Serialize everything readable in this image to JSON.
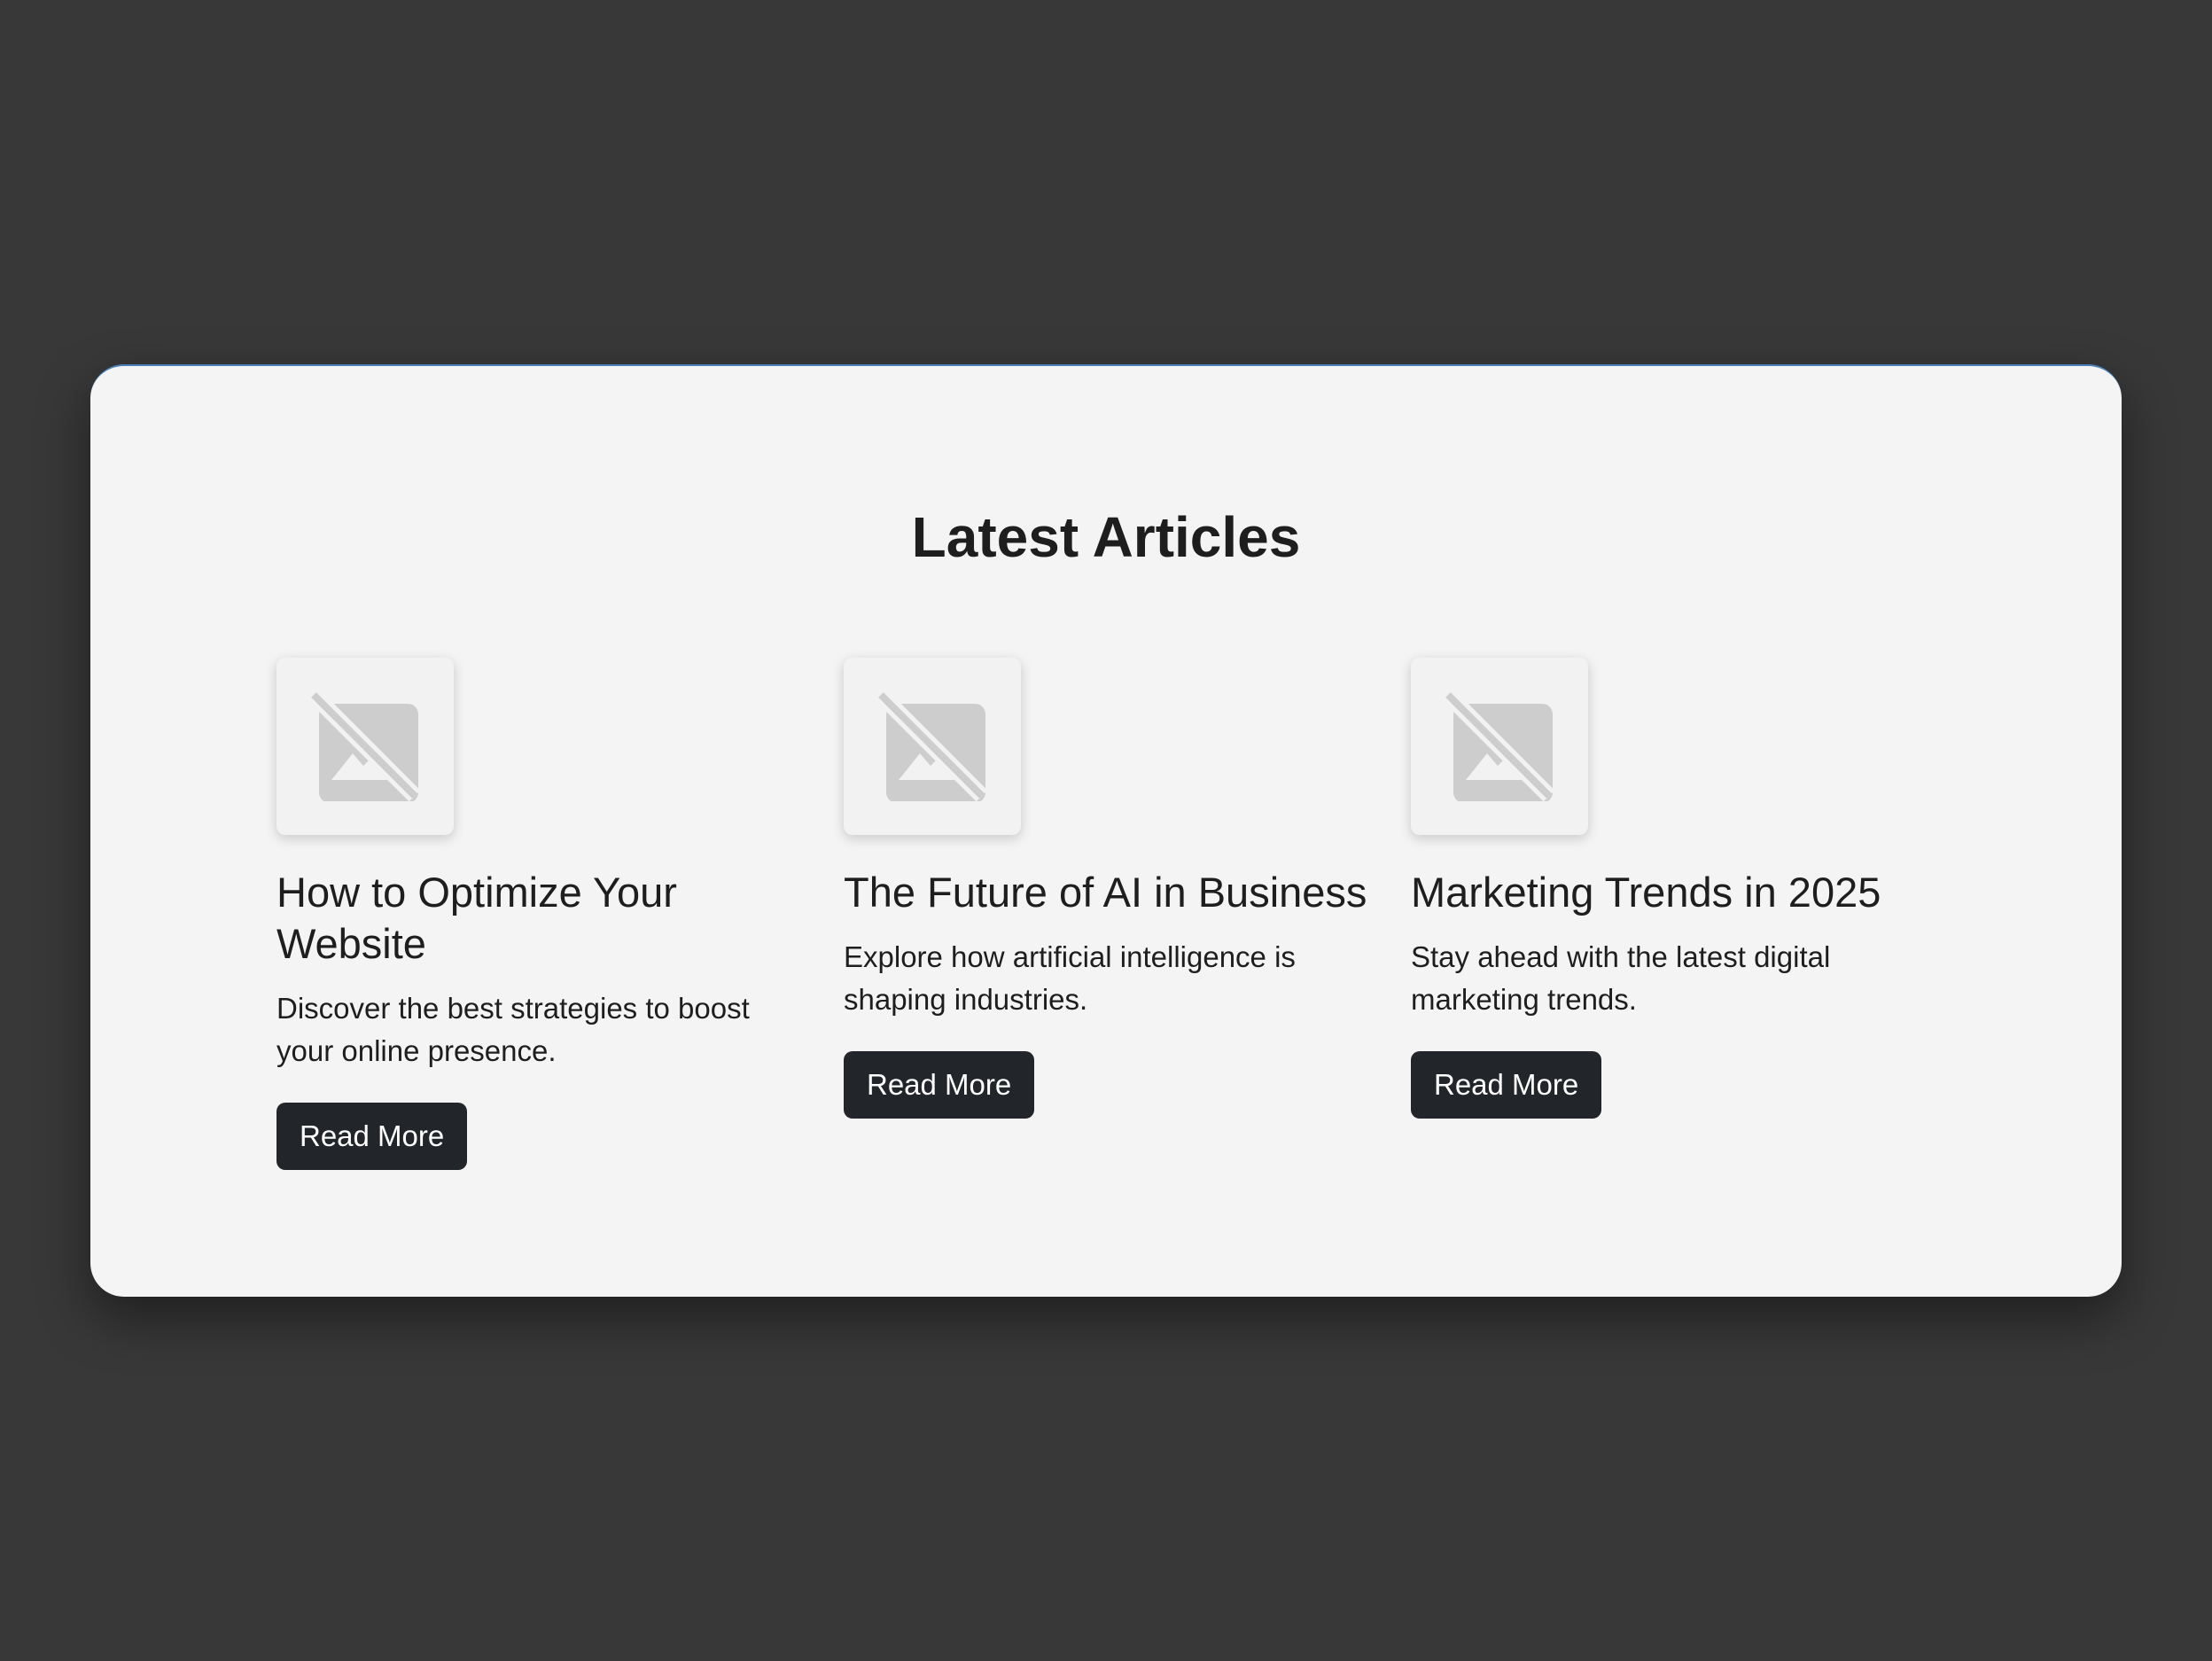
{
  "section": {
    "title": "Latest Articles"
  },
  "articles": [
    {
      "title": "How to Optimize Your Website",
      "description": "Discover the best strategies to boost your online presence.",
      "button_label": "Read More",
      "image_icon": "image-unavailable-icon"
    },
    {
      "title": "The Future of AI in Business",
      "description": "Explore how artificial intelligence is shaping industries.",
      "button_label": "Read More",
      "image_icon": "image-unavailable-icon"
    },
    {
      "title": "Marketing Trends in 2025",
      "description": "Stay ahead with the latest digital marketing trends.",
      "button_label": "Read More",
      "image_icon": "image-unavailable-icon"
    }
  ],
  "colors": {
    "page_background": "#383838",
    "panel_background": "#f4f4f4",
    "button_background": "#22252a",
    "button_text": "#ffffff",
    "icon_gray": "#cdcdcd"
  }
}
